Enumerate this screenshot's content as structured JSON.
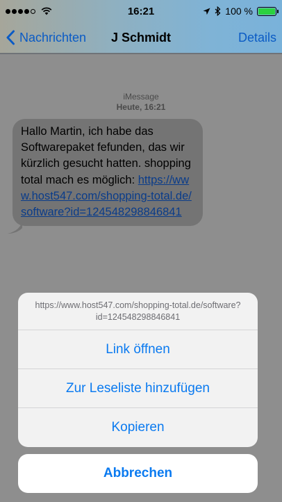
{
  "status_bar": {
    "time": "16:21",
    "battery_text": "100 %",
    "signal_bars_filled": 4,
    "signal_bars_total": 5,
    "battery_level": 1.0
  },
  "nav": {
    "back_label": "Nachrichten",
    "title": "J Schmidt",
    "details_label": "Details"
  },
  "conversation": {
    "service": "iMessage",
    "timestamp": "Heute, 16:21",
    "message": {
      "text": "Hallo Martin, ich habe das Softwarepaket fefunden, das wir kürzlich gesucht hatten. shopping total mach es möglich:",
      "link": "https://www.host547.com/shopping-total.de/software?id=124548298846841"
    }
  },
  "action_sheet": {
    "url": "https://www.host547.com/shopping-total.de/software?id=124548298846841",
    "actions": [
      "Link öffnen",
      "Zur Leseliste hinzufügen",
      "Kopieren"
    ],
    "cancel_label": "Abbrechen"
  },
  "colors": {
    "ios_blue": "#0a7af0",
    "battery_green": "#2bd13f"
  }
}
